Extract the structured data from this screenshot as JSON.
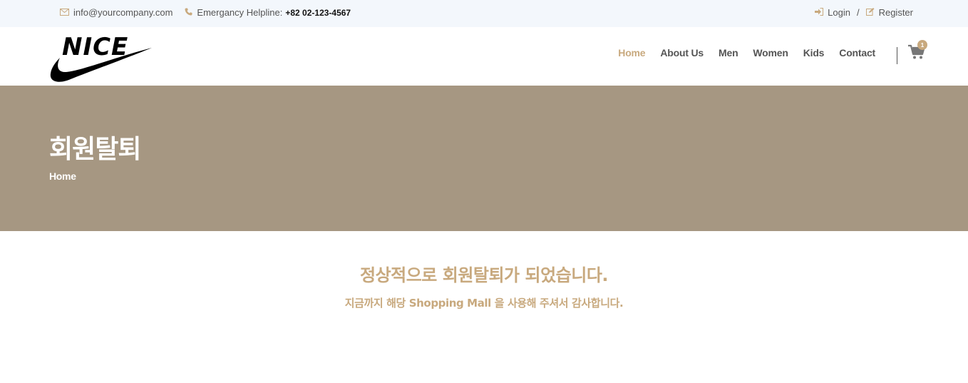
{
  "topbar": {
    "email": "info@yourcompany.com",
    "helpline_label": "Emergancy Helpline:",
    "helpline_number": "+82 02-123-4567",
    "login": "Login",
    "separator": "/",
    "register": "Register"
  },
  "header": {
    "logo_text": "NICE",
    "nav": [
      "Home",
      "About Us",
      "Men",
      "Women",
      "Kids",
      "Contact"
    ],
    "active_nav": "Home",
    "cart_count": "1"
  },
  "banner": {
    "title": "회원탈퇴",
    "breadcrumb": "Home"
  },
  "message": {
    "main": "정상적으로 회원탈퇴가 되었습니다.",
    "sub": "지금까지 해당 Shopping Mall 을 사용해 주셔서 감사합니다."
  },
  "colors": {
    "accent": "#c8a97e",
    "banner_bg": "#a69782",
    "topbar_bg": "#f3f7fc"
  },
  "icons": [
    "envelope-icon",
    "phone-icon",
    "login-icon",
    "edit-icon",
    "cart-icon"
  ]
}
